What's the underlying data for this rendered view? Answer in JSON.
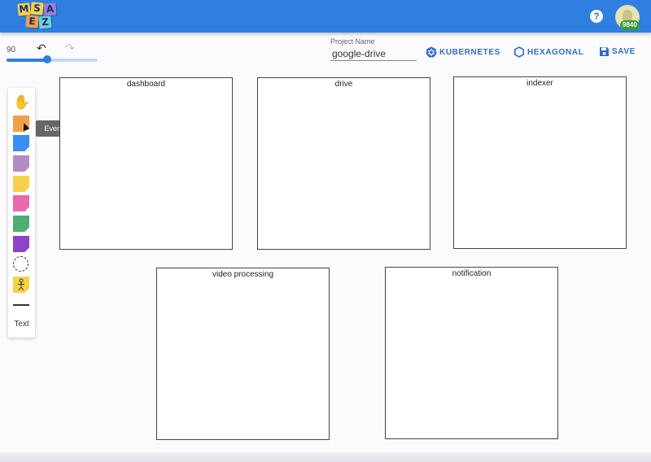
{
  "app": {
    "logo_letters": [
      "M",
      "S",
      "A",
      "E",
      "Z"
    ],
    "help_label": "?",
    "coin_count": "9840"
  },
  "toolbar": {
    "zoom": "90",
    "zoom_fraction": 0.45,
    "undo_icon": "↶",
    "redo_icon": "↷"
  },
  "project": {
    "label": "Project Name",
    "value": "google-drive"
  },
  "actions": {
    "kubernetes_label": "KUBERNETES",
    "hexagonal_label": "HEXAGONAL",
    "save_label": "SAVE"
  },
  "palette": {
    "hand_icon": "✋",
    "tooltip": "Event",
    "sticky_colors": {
      "event": "#f0a04b",
      "command": "#3b8ef0",
      "policy": "#b28cc4",
      "aggregate": "#f6d24a",
      "external": "#e96aaa",
      "view": "#4fae74",
      "ui": "#8e44c4",
      "actor": "#f6d24a"
    },
    "text_label": "Text"
  },
  "canvas": {
    "contexts": [
      "dashboard",
      "drive",
      "indexer",
      "video processing",
      "notification"
    ]
  }
}
